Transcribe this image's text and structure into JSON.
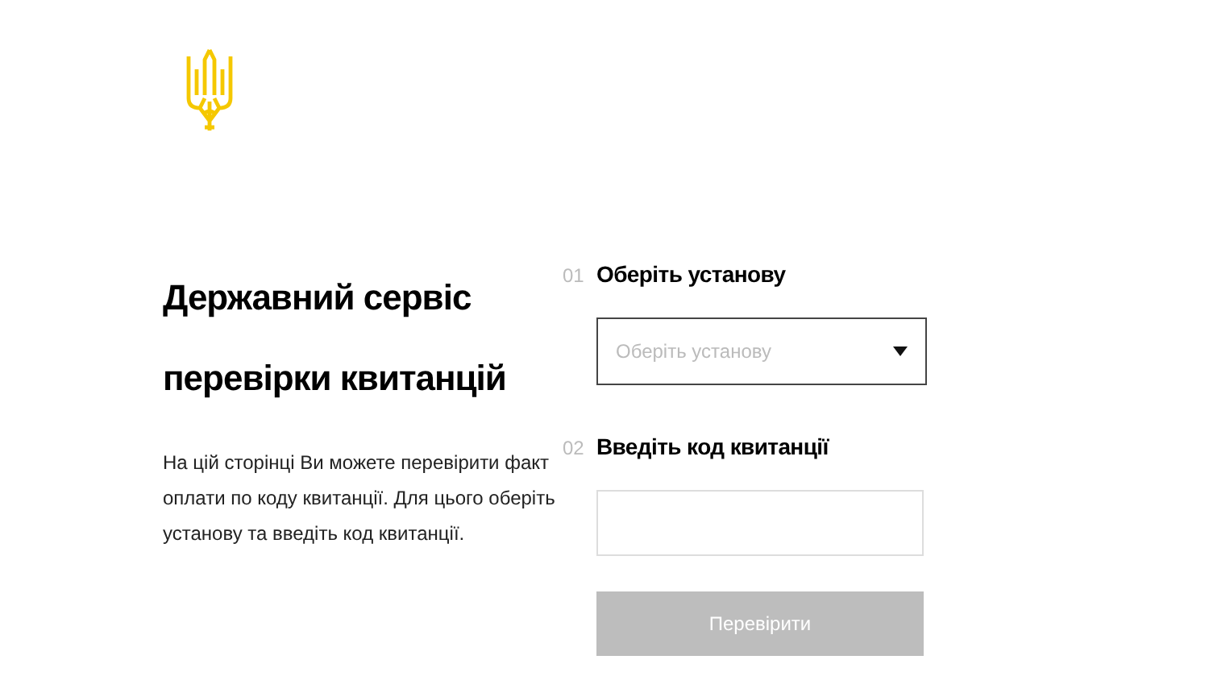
{
  "intro": {
    "title": "Державний сервіс перевірки квитанцій",
    "text": "На цій сторінці Ви можете перевірити факт оплати по коду квитанції. Для цього оберіть установу та введіть код квитанції."
  },
  "steps": [
    {
      "number": "01",
      "label": "Оберіть установу",
      "kind": "select",
      "placeholder": "Оберіть установу"
    },
    {
      "number": "02",
      "label": "Введіть код квитанції",
      "kind": "input"
    }
  ],
  "submit": {
    "label": "Перевірити",
    "disabled": true
  }
}
